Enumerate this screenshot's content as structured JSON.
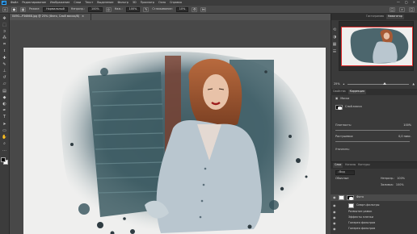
{
  "menubar": {
    "logo": "Ps",
    "items": [
      "Файл",
      "Редактирование",
      "Изображение",
      "Слои",
      "Текст",
      "Выделение",
      "Фильтр",
      "3D",
      "Просмотр",
      "Окно",
      "Справка"
    ],
    "window_controls": [
      "—",
      "▢",
      "✕"
    ]
  },
  "options": {
    "mode_label": "Режим:",
    "mode_value": "Нормальный",
    "opacity_label": "Непрозр.:",
    "opacity_value": "100%",
    "flow_label": "Наж.:",
    "flow_value": "100%",
    "smoothing_label": "Сглаживание:",
    "smoothing_value": "10%",
    "right_icons": [
      "□",
      "⌕",
      "▢"
    ]
  },
  "document": {
    "tab_title": "0490—P36868.jpg @ 25% (Фото, Слой маски/8)",
    "close": "×"
  },
  "panels": {
    "top_tabs": [
      "Гистограмма",
      "Навигатор"
    ],
    "active_top_tab": "Навигатор",
    "zoom": "25%",
    "props_tabs": [
      "Свойства",
      "Коррекция"
    ],
    "props_title": "Маски",
    "mask_label": "Слой-маска",
    "density_label": "Плотность:",
    "density_value": "100%",
    "feather_label": "Растушевка:",
    "feather_value": "0,0 пикс.",
    "refine_label": "Уточнить:",
    "layers_tabs": [
      "Слои",
      "Каналы",
      "Контуры"
    ],
    "search_label": "Вид",
    "blend_mode": "Обычные",
    "opacity_label": "Непрозр.:",
    "opacity_value": "100%",
    "fill_label": "Заливка:",
    "fill_value": "100%",
    "layers": [
      {
        "name": "Фото",
        "selected": true
      },
      {
        "name": "Смарт-фильтры",
        "selected": false
      },
      {
        "name": "Размытие рамок",
        "selected": false
      },
      {
        "name": "Эффекты пленки",
        "selected": false
      },
      {
        "name": "Галерея фильтров",
        "selected": false
      },
      {
        "name": "Галерея фильтров",
        "selected": false
      }
    ]
  },
  "colors": {
    "accent": "#31a8ff",
    "nav_frame": "#e02b2b",
    "canvas_bg": "#efefee"
  },
  "icons": [
    "move-icon",
    "marquee-icon",
    "lasso-icon",
    "quick-select-icon",
    "crop-icon",
    "eyedropper-icon",
    "healing-icon",
    "brush-icon",
    "stamp-icon",
    "history-brush-icon",
    "eraser-icon",
    "gradient-icon",
    "blur-icon",
    "dodge-icon",
    "pen-icon",
    "type-icon",
    "path-select-icon",
    "shape-icon",
    "hand-icon",
    "zoom-icon"
  ]
}
